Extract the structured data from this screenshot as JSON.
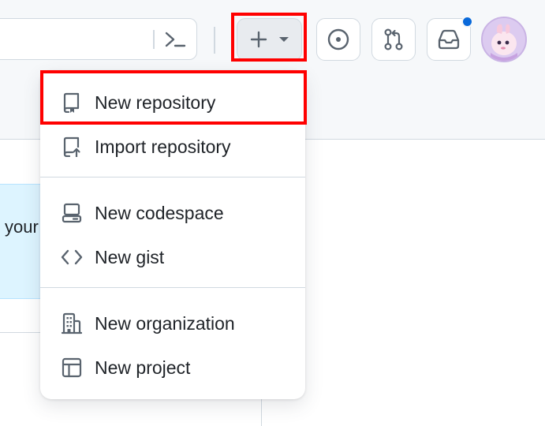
{
  "banner": {
    "partial_text": "your"
  },
  "header": {
    "command_palette_icon": "terminal-icon",
    "create_button_icons": [
      "plus-icon",
      "triangle-down-icon"
    ],
    "issues_icon": "issue-opened-icon",
    "pull_requests_icon": "git-pull-request-icon",
    "inbox_icon": "inbox-icon",
    "notification_color": "#0969da"
  },
  "menu": {
    "items": [
      {
        "label": "New repository",
        "icon": "repo-icon"
      },
      {
        "label": "Import repository",
        "icon": "repo-push-icon"
      },
      {
        "label": "New codespace",
        "icon": "codespaces-icon"
      },
      {
        "label": "New gist",
        "icon": "code-icon"
      },
      {
        "label": "New organization",
        "icon": "organization-icon"
      },
      {
        "label": "New project",
        "icon": "table-icon"
      }
    ]
  },
  "highlight_color": "#ff0000"
}
